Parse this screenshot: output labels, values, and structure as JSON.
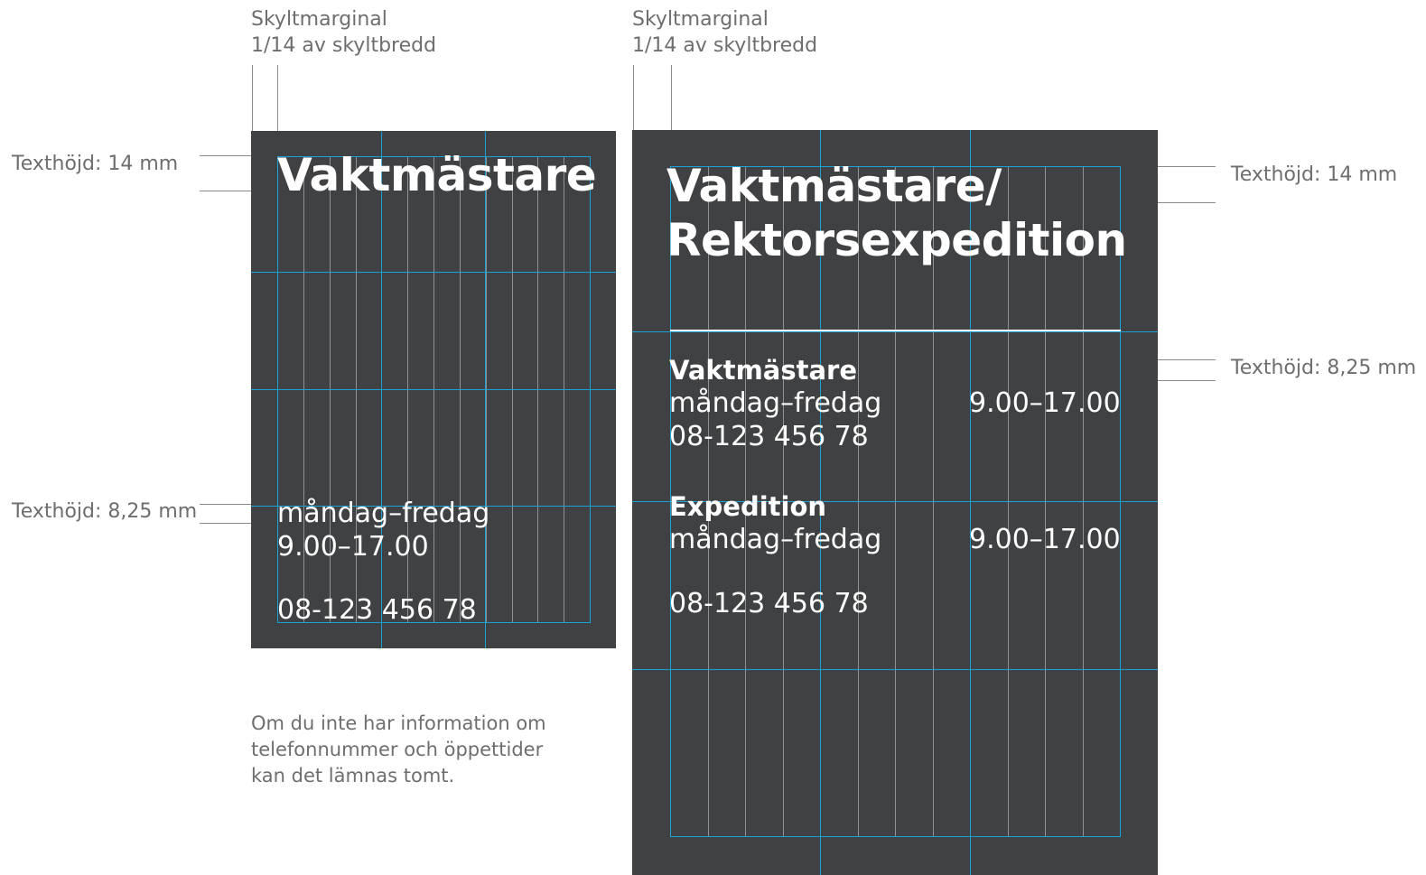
{
  "colors": {
    "sign_bg": "#3f4143",
    "grid_major": "#1ba1d9",
    "grid_minor": "#8f9193",
    "annotation": "#6d6e70",
    "sign_text": "#ffffff"
  },
  "left_sign": {
    "margin_label_1": "Skyltmarginal",
    "margin_label_2": "1/14 av skyltbredd",
    "title_height_label": "Texthöjd: 14 mm",
    "body_height_label": "Texthöjd: 8,25 mm",
    "title": "Vaktmästare",
    "days": "måndag–fredag",
    "hours": "9.00–17.00",
    "phone": "08-123 456 78",
    "description": [
      "Om du inte har information om",
      "telefonnummer och öppettider",
      "kan det lämnas tomt."
    ]
  },
  "right_sign": {
    "margin_label_1": "Skyltmarginal",
    "margin_label_2": "1/14 av skyltbredd",
    "title_height_label": "Texthöjd: 14 mm",
    "body_height_label": "Texthöjd: 8,25 mm",
    "title_line_1": "Vaktmästare/",
    "title_line_2": "Rektorsexpedition",
    "section_1": {
      "heading": "Vaktmästare",
      "days": "måndag–fredag",
      "hours": "9.00–17.00",
      "phone": "08-123 456 78"
    },
    "section_2": {
      "heading": "Expedition",
      "days": "måndag–fredag",
      "hours": "9.00–17.00",
      "phone": "08-123 456 78"
    }
  }
}
